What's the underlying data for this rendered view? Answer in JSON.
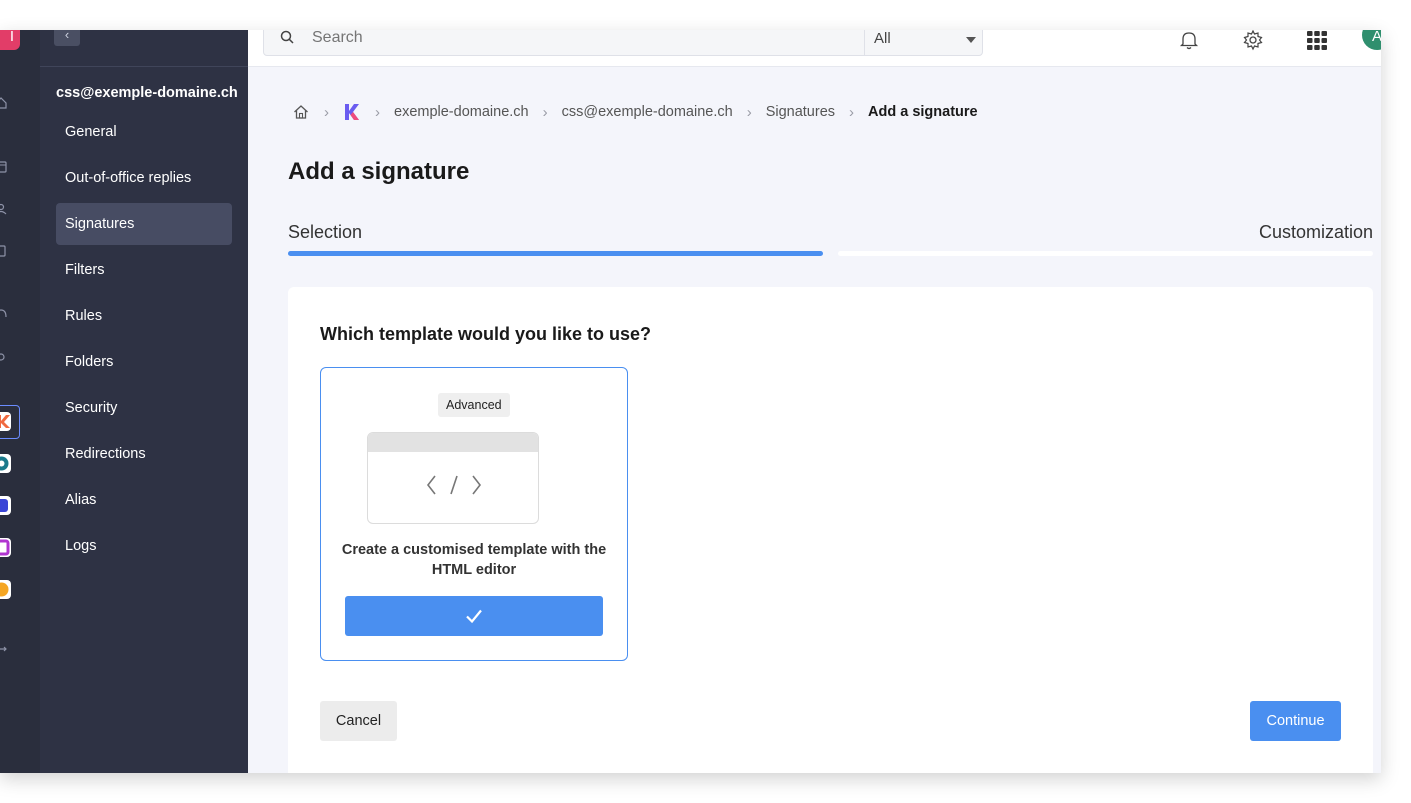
{
  "rail": {
    "brand_letter": "I",
    "icons": [
      "home-icon",
      "calendar-icon",
      "contacts-icon",
      "document-icon",
      "headset-icon",
      "settings-icon"
    ],
    "apps": [
      "kmail-app-icon",
      "kdrive-app-icon",
      "kchat-app-icon",
      "kmeet-app-icon",
      "ksuite-app-icon"
    ],
    "bottom_icon": "logout-icon"
  },
  "sidebar": {
    "account": "css@exemple-domaine.ch",
    "items": [
      {
        "label": "General"
      },
      {
        "label": "Out-of-office replies"
      },
      {
        "label": "Signatures",
        "active": true
      },
      {
        "label": "Filters"
      },
      {
        "label": "Rules"
      },
      {
        "label": "Folders"
      },
      {
        "label": "Security"
      },
      {
        "label": "Redirections"
      },
      {
        "label": "Alias"
      },
      {
        "label": "Logs"
      }
    ]
  },
  "topbar": {
    "search_placeholder": "Search",
    "filter_value": "All",
    "avatar_initial": "A",
    "icons": [
      "bell-icon",
      "gear-icon",
      "apps-grid-icon"
    ]
  },
  "breadcrumb": {
    "domain": "exemple-domaine.ch",
    "account": "css@exemple-domaine.ch",
    "section": "Signatures",
    "current": "Add a signature"
  },
  "page": {
    "title": "Add a signature",
    "steps": [
      {
        "label": "Selection",
        "active": true
      },
      {
        "label": "Customization",
        "active": false
      }
    ],
    "progress": 0.5
  },
  "card": {
    "question": "Which template would you like to use?",
    "template": {
      "badge": "Advanced",
      "description": "Create a customised template with the HTML editor",
      "selected": true
    }
  },
  "actions": {
    "cancel": "Cancel",
    "continue": "Continue"
  },
  "colors": {
    "accent": "#4a8ff0",
    "sidebar_bg": "#2e3244",
    "rail_bg": "#2a2e3d",
    "brand": "#e23d68",
    "avatar": "#2f8f6e",
    "page_bg": "#f4f5fb"
  }
}
